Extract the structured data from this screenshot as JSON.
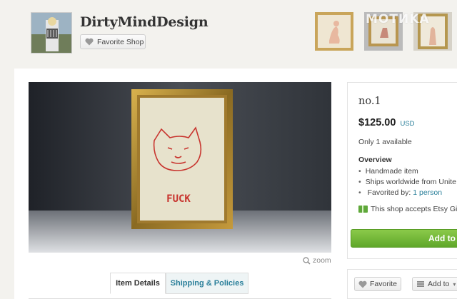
{
  "shop": {
    "name": "DirtyMindDesign",
    "favorite_shop_label": "Favorite Shop"
  },
  "watermark": "MOTИKA",
  "listing": {
    "title": "no.1",
    "price": "$125.00",
    "currency": "USD",
    "availability": "Only 1 available",
    "overview_heading": "Overview",
    "overview_items": [
      "Handmade item",
      "Ships worldwide from Unite"
    ],
    "favorited_by_label": "Favorited by:",
    "favorited_by_value": "1 person",
    "gift_card_text": "This shop accepts Etsy Gi",
    "add_to_cart_label": "Add to c",
    "embroidered_text": "FUCK"
  },
  "image_controls": {
    "zoom_label": "zoom"
  },
  "tabs": [
    {
      "label": "Item Details"
    },
    {
      "label": "Shipping & Policies"
    }
  ],
  "actions": {
    "favorite_label": "Favorite",
    "add_to_label": "Add to"
  },
  "colors": {
    "link": "#2a7f9a",
    "add_button": "#6fb337",
    "background": "#f3f2ee"
  },
  "icons": [
    "heart-icon",
    "zoom-icon",
    "gift-card-icon",
    "list-icon",
    "dropdown-arrow-icon"
  ]
}
